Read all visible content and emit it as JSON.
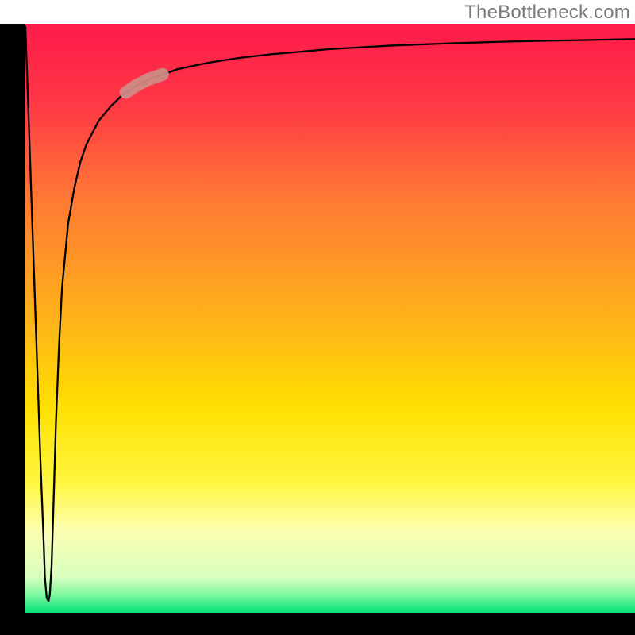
{
  "watermark": "TheBottleneck.com",
  "chart_data": {
    "type": "line",
    "title": "",
    "xlabel": "",
    "ylabel": "",
    "xlim": [
      0,
      100
    ],
    "ylim": [
      0,
      100
    ],
    "background_gradient": {
      "type": "vertical",
      "stops": [
        {
          "pos": 0.0,
          "color": "#ff1a4b"
        },
        {
          "pos": 0.14,
          "color": "#ff3945"
        },
        {
          "pos": 0.3,
          "color": "#ff7a33"
        },
        {
          "pos": 0.5,
          "color": "#ffb21a"
        },
        {
          "pos": 0.65,
          "color": "#ffe000"
        },
        {
          "pos": 0.78,
          "color": "#fff640"
        },
        {
          "pos": 0.86,
          "color": "#fdffb0"
        },
        {
          "pos": 0.94,
          "color": "#d8ffc0"
        },
        {
          "pos": 0.97,
          "color": "#7cf7a0"
        },
        {
          "pos": 1.0,
          "color": "#00e478"
        }
      ]
    },
    "axes_color": "#000000",
    "axes_width_left": 32,
    "axes_width_bottom": 28,
    "curve_color": "#000000",
    "curve_width": 2.3,
    "curve_description": "deep narrow V near the left edge that rapidly rises and asymptotically approaches 100%",
    "series": [
      {
        "name": "bottleneck-curve",
        "x": [
          0.0,
          0.5,
          1.0,
          1.5,
          2.0,
          2.5,
          3.0,
          3.2,
          3.5,
          3.8,
          4.0,
          4.3,
          4.6,
          5.0,
          5.5,
          6.0,
          7.0,
          8.0,
          9.0,
          10.0,
          12.0,
          14.0,
          16.0,
          18.0,
          20.0,
          25.0,
          30.0,
          35.0,
          40.0,
          50.0,
          60.0,
          70.0,
          80.0,
          90.0,
          100.0
        ],
        "y": [
          99.5,
          85,
          70,
          55,
          40,
          25,
          12,
          6,
          2.5,
          2.0,
          3.0,
          8,
          18,
          32,
          45,
          55,
          66,
          72,
          76.5,
          79.5,
          83.5,
          86,
          88,
          89.4,
          90.5,
          92.3,
          93.4,
          94.2,
          94.8,
          95.7,
          96.3,
          96.7,
          97.0,
          97.2,
          97.4
        ]
      }
    ],
    "highlight_segment": {
      "description": "short rounded pink segment along the curve",
      "color": "#cf8d87",
      "x_range": [
        16.5,
        22.5
      ],
      "thickness": 16
    }
  }
}
